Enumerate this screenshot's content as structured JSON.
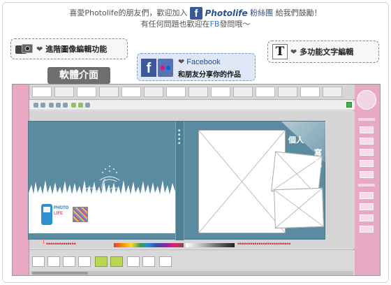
{
  "header": {
    "line1_pre": "喜愛Photolife的朋友們，歡迎加入",
    "fb_letter": "f",
    "fb_brand": "Photolife",
    "fans": "粉絲團",
    "line1_post": "給我們鼓勵！",
    "line2_pre": "有任何問題也歡迎在",
    "line2_fb": "FB",
    "line2_post": "發問哦～"
  },
  "features": {
    "heart": "❤",
    "image_editing": "進階圖像編輯功能",
    "facebook_title": "Facebook",
    "facebook_sub": "和朋友分享你的作品",
    "text_editing": "多功能文字編輯",
    "text_icon": "T"
  },
  "callout": {
    "label": "軟體介面"
  },
  "app": {
    "photo_labels": {
      "ge": "個人",
      "xie": "寫真"
    },
    "logo": {
      "line1": "PHOTO",
      "line2": "LIFE"
    }
  },
  "colors": {
    "pink_panel": "#e7a9c4",
    "page_blue": "#5a8ba1",
    "facebook": "#3b5998",
    "callout_gray": "#6e6e6e"
  }
}
